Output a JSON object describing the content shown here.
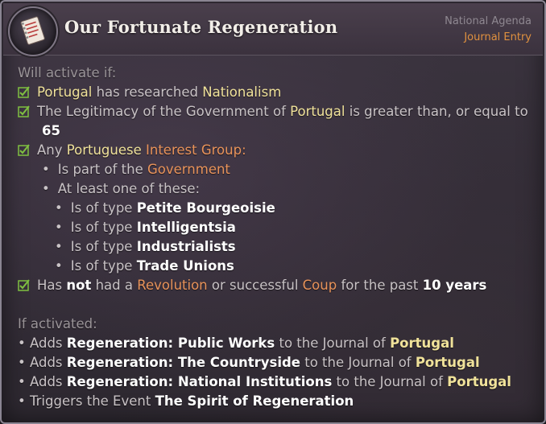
{
  "header": {
    "title": "Our Fortunate Regeneration",
    "category": "National Agenda",
    "type": "Journal Entry",
    "icon": "journal-scroll-icon"
  },
  "conditions": {
    "heading": "Will activate if:",
    "c1": {
      "country": "Portugal",
      "text": " has researched ",
      "tech": "Nationalism"
    },
    "c2": {
      "pre": "The Legitimacy of the Government of ",
      "country": "Portugal",
      "post": " is greater than, or equal to",
      "value": "65"
    },
    "c3": {
      "pre": "Any ",
      "adj": "Portuguese",
      "ig": "Interest Group",
      "colon": ":",
      "sub1_pre": "Is part of the ",
      "sub1_link": "Government",
      "sub2": "At least one of these:",
      "type_prefix": "Is of type ",
      "types": [
        "Petite Bourgeoisie",
        "Intelligentsia",
        "Industrialists",
        "Trade Unions"
      ]
    },
    "c4": {
      "pre": "Has ",
      "not": "not",
      "mid": " had a ",
      "rev": "Revolution",
      "or": " or successful ",
      "coup": "Coup",
      "post": " for the past ",
      "years": "10 years"
    }
  },
  "effects": {
    "heading": "If activated:",
    "adds_prefix": "Adds ",
    "adds_mid": " to the Journal of ",
    "country": "Portugal",
    "journals": [
      "Regeneration: Public Works",
      "Regeneration: The Countryside",
      "Regeneration: National Institutions"
    ],
    "event_pre": "Triggers the Event ",
    "event": "The Spirit of Regeneration"
  },
  "colors": {
    "highlight_yellow": "#f0e29a",
    "highlight_orange": "#e8935a",
    "check_green": "#7fc040",
    "category_orange": "#e0913f"
  }
}
